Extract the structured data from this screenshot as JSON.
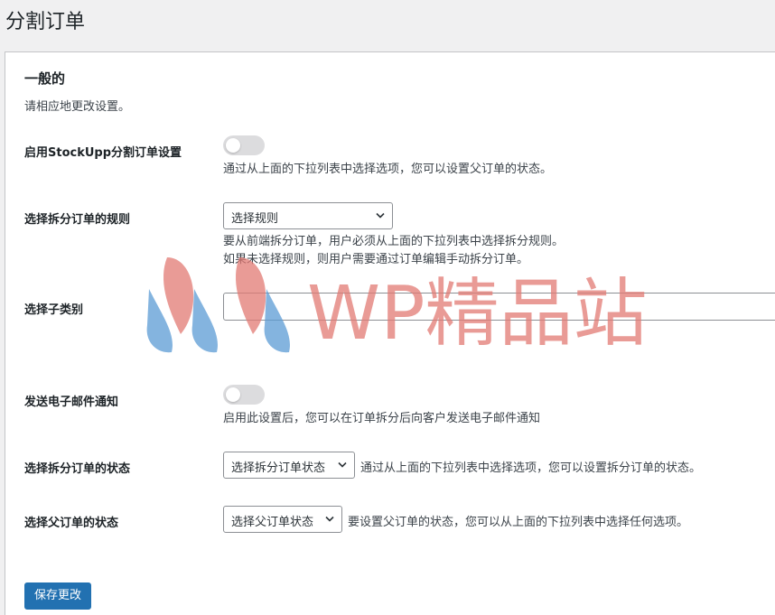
{
  "page": {
    "title": "分割订单"
  },
  "section": {
    "title": "一般的",
    "description": "请相应地更改设置。"
  },
  "rows": {
    "enable": {
      "label": "启用StockUpp分割订单设置",
      "description": "通过从上面的下拉列表中选择选项，您可以设置父订单的状态。",
      "enabled": false
    },
    "rule": {
      "label": "选择拆分订单的规则",
      "selected": "选择规则",
      "description_1": "要从前端拆分订单，用户必须从上面的下拉列表中选择拆分规则。",
      "description_2": "如果未选择规则，则用户需要通过订单编辑手动拆分订单。"
    },
    "subcategory": {
      "label": "选择子类别",
      "value": ""
    },
    "email": {
      "label": "发送电子邮件通知",
      "description": "启用此设置后，您可以在订单拆分后向客户发送电子邮件通知",
      "enabled": false
    },
    "split_status": {
      "label": "选择拆分订单的状态",
      "selected": "选择拆分订单状态",
      "description": "通过从上面的下拉列表中选择选项，您可以设置拆分订单的状态。"
    },
    "parent_status": {
      "label": "选择父订单的状态",
      "selected": "选择父订单状态",
      "description": "要设置父订单的状态，您可以从上面的下拉列表中选择任何选项。"
    }
  },
  "actions": {
    "save_label": "保存更改"
  },
  "watermark": {
    "text": "WP精品站"
  },
  "colors": {
    "primary": "#2271b1",
    "toggle_off": "#dcdcde",
    "watermark_red": "#e27a74",
    "watermark_blue": "#5b9bd5"
  }
}
